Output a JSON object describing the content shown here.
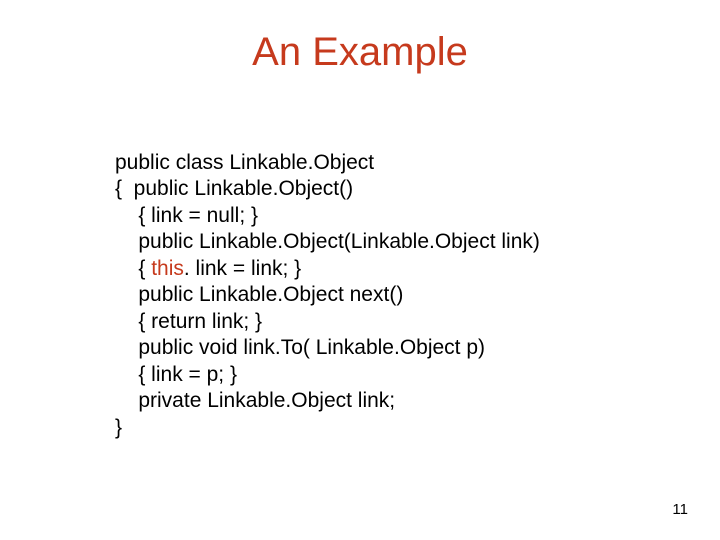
{
  "title": "An Example",
  "code": {
    "l1": "public class Linkable.Object",
    "l2": "{  public Linkable.Object()",
    "l3": "    { link = null; }",
    "l4": "    public Linkable.Object(Linkable.Object link)",
    "l5a": "    { ",
    "l5_this": "this",
    "l5b": ". link = link; }",
    "l6": "    public Linkable.Object next()",
    "l7": "    { return link; }",
    "l8": "    public void link.To( Linkable.Object p)",
    "l9": "    { link = p; }",
    "l10": "    private Linkable.Object link;",
    "l11": "}"
  },
  "page_number": "11"
}
